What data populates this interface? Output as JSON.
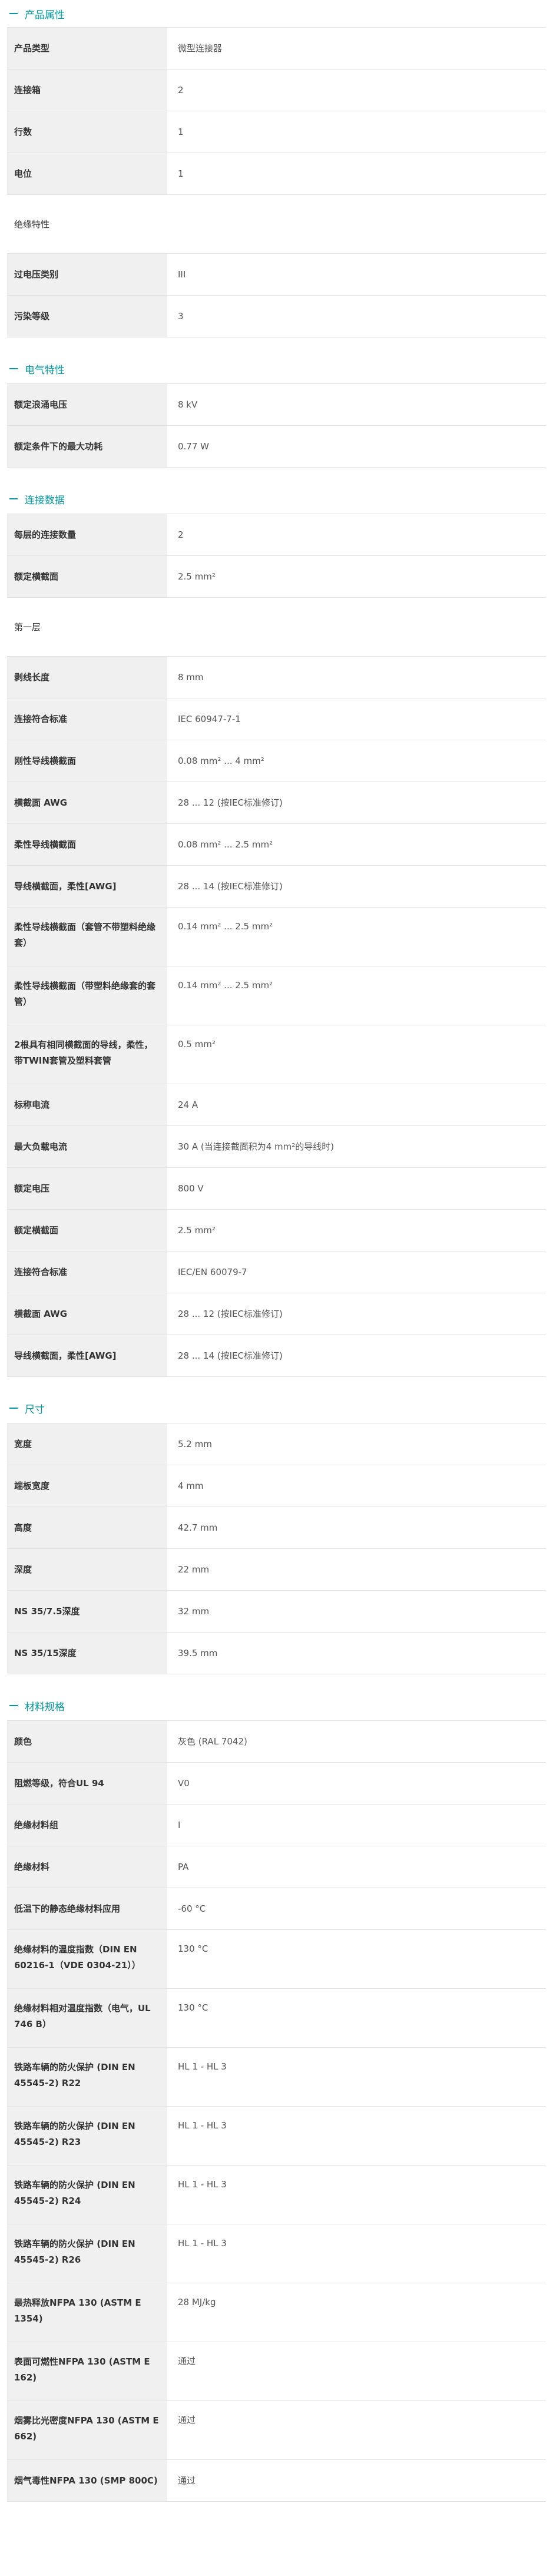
{
  "sections": [
    {
      "title": "产品属性",
      "rows": [
        {
          "label": "产品类型",
          "value": "微型连接器"
        },
        {
          "label": "连接箱",
          "value": "2"
        },
        {
          "label": "行数",
          "value": "1"
        },
        {
          "label": "电位",
          "value": "1"
        }
      ],
      "group": {
        "title": "绝缘特性",
        "rows": [
          {
            "label": "过电压类别",
            "value": "III"
          },
          {
            "label": "污染等级",
            "value": "3"
          }
        ]
      }
    },
    {
      "title": "电气特性",
      "rows": [
        {
          "label": "额定浪涌电压",
          "value": "8 kV"
        },
        {
          "label": "额定条件下的最大功耗",
          "value": "0.77 W"
        }
      ]
    },
    {
      "title": "连接数据",
      "rows": [
        {
          "label": "每层的连接数量",
          "value": "2"
        },
        {
          "label": "额定横截面",
          "value": "2.5 mm²"
        }
      ],
      "group": {
        "title": "第一层",
        "rows": [
          {
            "label": "剥线长度",
            "value": "8 mm"
          },
          {
            "label": "连接符合标准",
            "value": "IEC 60947-7-1"
          },
          {
            "label": "刚性导线横截面",
            "value": "0.08 mm² ... 4 mm²"
          },
          {
            "label": "横截面 AWG",
            "value": "28 ... 12 (按IEC标准修订)"
          },
          {
            "label": "柔性导线横截面",
            "value": "0.08 mm² ... 2.5 mm²"
          },
          {
            "label": "导线横截面，柔性[AWG]",
            "value": "28 ... 14 (按IEC标准修订)"
          },
          {
            "label": "柔性导线横截面（套管不带塑料绝缘套）",
            "value": "0.14 mm² ... 2.5 mm²",
            "tall": true
          },
          {
            "label": "柔性导线横截面（带塑料绝缘套的套管）",
            "value": "0.14 mm² ... 2.5 mm²",
            "tall": true
          },
          {
            "label": "2根具有相同横截面的导线，柔性，带TWIN套管及塑料套管",
            "value": "0.5 mm²",
            "tall": true
          },
          {
            "label": "标称电流",
            "value": "24 A"
          },
          {
            "label": "最大负载电流",
            "value": "30 A (当连接截面积为4 mm²的导线时)"
          },
          {
            "label": "额定电压",
            "value": "800 V"
          },
          {
            "label": "额定横截面",
            "value": "2.5 mm²"
          },
          {
            "label": "连接符合标准",
            "value": "IEC/EN 60079-7"
          },
          {
            "label": "横截面 AWG",
            "value": "28 ... 12 (按IEC标准修订)"
          },
          {
            "label": "导线横截面，柔性[AWG]",
            "value": "28 ... 14 (按IEC标准修订)"
          }
        ]
      }
    },
    {
      "title": "尺寸",
      "rows": [
        {
          "label": "宽度",
          "value": "5.2 mm"
        },
        {
          "label": "端板宽度",
          "value": "4 mm"
        },
        {
          "label": "高度",
          "value": "42.7 mm"
        },
        {
          "label": "深度",
          "value": "22 mm"
        },
        {
          "label": "NS 35/7.5深度",
          "value": "32 mm"
        },
        {
          "label": "NS 35/15深度",
          "value": "39.5 mm"
        }
      ]
    },
    {
      "title": "材料规格",
      "rows": [
        {
          "label": "颜色",
          "value": "灰色 (RAL 7042)"
        },
        {
          "label": "阻燃等级，符合UL 94",
          "value": "V0"
        },
        {
          "label": "绝缘材料组",
          "value": "I"
        },
        {
          "label": "绝缘材料",
          "value": "PA"
        },
        {
          "label": "低温下的静态绝缘材料应用",
          "value": "-60 °C"
        },
        {
          "label": "绝缘材料的温度指数（DIN EN 60216-1（VDE 0304-21））",
          "value": "130 °C",
          "tall": true
        },
        {
          "label": "绝缘材料相对温度指数（电气，UL 746 B）",
          "value": "130 °C",
          "tall": true
        },
        {
          "label": "铁路车辆的防火保护 (DIN EN 45545-2) R22",
          "value": "HL 1 - HL 3",
          "tall": true
        },
        {
          "label": "铁路车辆的防火保护 (DIN EN 45545-2) R23",
          "value": "HL 1 - HL 3",
          "tall": true
        },
        {
          "label": "铁路车辆的防火保护 (DIN EN 45545-2) R24",
          "value": "HL 1 - HL 3",
          "tall": true
        },
        {
          "label": "铁路车辆的防火保护 (DIN EN 45545-2) R26",
          "value": "HL 1 - HL 3",
          "tall": true
        },
        {
          "label": "最热释放NFPA 130 (ASTM E 1354)",
          "value": "28 MJ/kg",
          "tall": true
        },
        {
          "label": "表面可燃性NFPA 130 (ASTM E 162)",
          "value": "通过",
          "tall": true
        },
        {
          "label": "烟雾比光密度NFPA 130 (ASTM E 662)",
          "value": "通过",
          "tall": true
        },
        {
          "label": "烟气毒性NFPA 130 (SMP 800C)",
          "value": "通过"
        }
      ]
    }
  ]
}
